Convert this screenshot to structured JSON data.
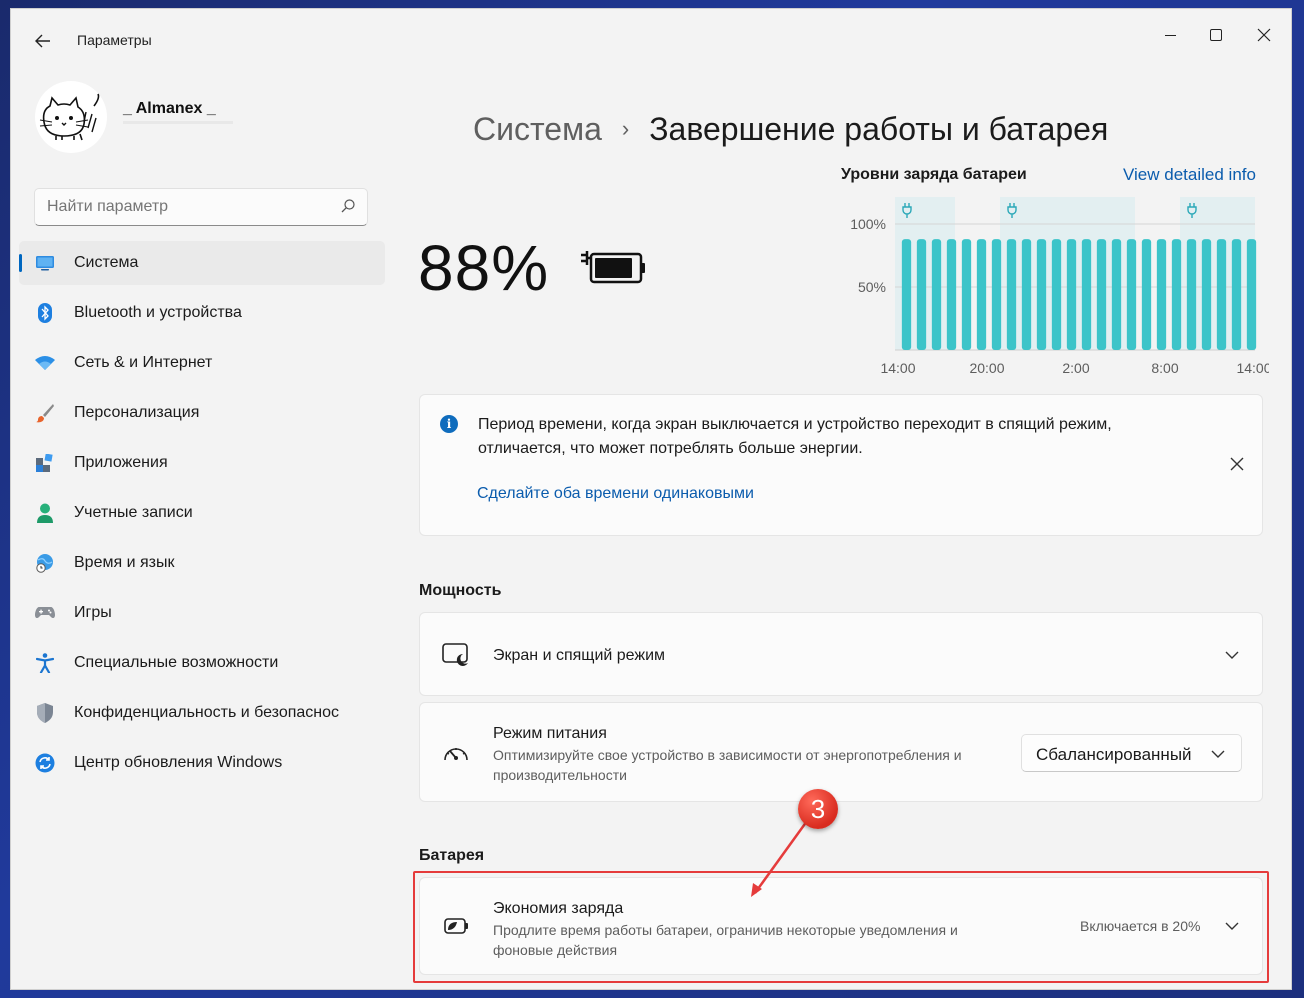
{
  "window": {
    "title": "Параметры"
  },
  "user": {
    "name": "_ Almanex _"
  },
  "search": {
    "placeholder": "Найти параметр"
  },
  "sidebar": {
    "items": [
      {
        "label": "Система",
        "icon": "system-icon"
      },
      {
        "label": "Bluetooth и устройства",
        "icon": "bluetooth-icon"
      },
      {
        "label": "Сеть & и Интернет",
        "icon": "wifi-icon"
      },
      {
        "label": "Персонализация",
        "icon": "brush-icon"
      },
      {
        "label": "Приложения",
        "icon": "apps-icon"
      },
      {
        "label": "Учетные записи",
        "icon": "account-icon"
      },
      {
        "label": "Время и язык",
        "icon": "globe-clock-icon"
      },
      {
        "label": "Игры",
        "icon": "gamepad-icon"
      },
      {
        "label": "Специальные возможности",
        "icon": "accessibility-icon"
      },
      {
        "label": "Конфиденциальность и безопаснос",
        "icon": "shield-icon"
      },
      {
        "label": "Центр обновления Windows",
        "icon": "update-icon"
      }
    ]
  },
  "breadcrumb": {
    "parent": "Система",
    "separator": "›",
    "current": "Завершение работы и батарея"
  },
  "battery": {
    "percent": "88%",
    "icon": "battery-charging-icon",
    "level": 0.88
  },
  "chart": {
    "title": "Уровни заряда батареи",
    "link": "View detailed info"
  },
  "chart_data": {
    "type": "bar",
    "title": "Уровни заряда батареи",
    "y_tick_labels": [
      "100%",
      "50%"
    ],
    "x_tick_labels": [
      "14:00",
      "20:00",
      "2:00",
      "8:00",
      "14:00"
    ],
    "ylim": [
      0,
      100
    ],
    "values": [
      88,
      88,
      88,
      88,
      88,
      88,
      88,
      88,
      88,
      88,
      88,
      88,
      88,
      88,
      88,
      88,
      88,
      88,
      88,
      88,
      88,
      88,
      88,
      88
    ],
    "charging_periods_bar_index": [
      [
        0,
        3
      ],
      [
        7,
        15
      ],
      [
        19,
        23
      ]
    ],
    "bar_color": "#3cc4c9",
    "charging_band_color": "#e3eff1",
    "grid": true
  },
  "info": {
    "text": "Период времени, когда экран выключается и устройство переходит в спящий режим, отличается, что может потреблять больше энергии.",
    "link": "Сделайте оба времени одинаковыми"
  },
  "power": {
    "heading": "Мощность",
    "screen_sleep": {
      "title": "Экран и спящий режим"
    },
    "power_mode": {
      "title": "Режим питания",
      "desc": "Оптимизируйте свое устройство в зависимости от энергопотребления и производительности",
      "value": "Сбалансированный"
    }
  },
  "battery_section": {
    "heading": "Батарея",
    "saver": {
      "title": "Экономия заряда",
      "desc": "Продлите время работы батареи, ограничив некоторые уведомления и фоновые действия",
      "value": "Включается в 20%"
    }
  },
  "annotation": {
    "number": "3",
    "color": "#e53b3b"
  }
}
